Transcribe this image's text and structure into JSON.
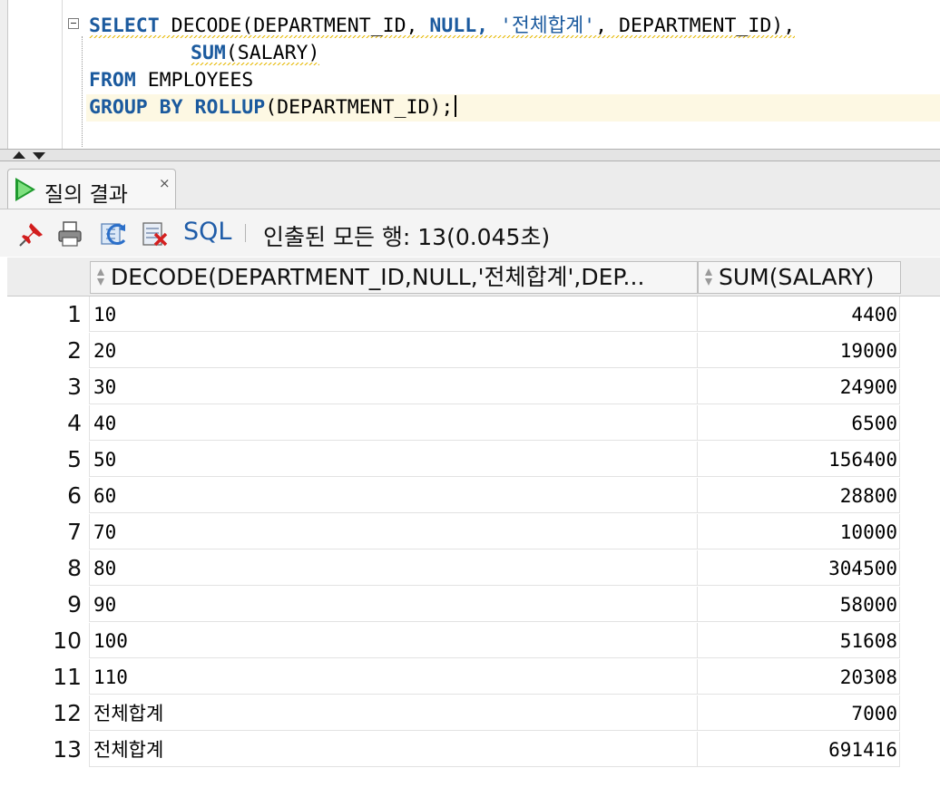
{
  "editor": {
    "line1": {
      "kw_select": "SELECT",
      "fn_decode": "DECODE(DEPARTMENT_ID,",
      "kw_null": "NULL,",
      "str_total": "'전체합계'",
      "rest": ", DEPARTMENT_ID),"
    },
    "line2": {
      "kw_sum": "SUM",
      "rest": "(SALARY)"
    },
    "line3": {
      "kw_from": "FROM",
      "rest": "EMPLOYEES"
    },
    "line4": {
      "kw_group": "GROUP BY",
      "kw_rollup": "ROLLUP",
      "rest": "(DEPARTMENT_ID);"
    }
  },
  "results_tab": {
    "label": "질의 결과",
    "close": "×",
    "icon": "run-query-icon"
  },
  "toolbar": {
    "icons": [
      "pin-icon",
      "print-icon",
      "refresh-icon",
      "clear-icon"
    ],
    "sql_label": "SQL",
    "status": "인출된 모든 행: 13(0.045초)"
  },
  "grid": {
    "columns": [
      "DECODE(DEPARTMENT_ID,NULL,'전체합계',DEP...",
      "SUM(SALARY)"
    ],
    "rows": [
      {
        "n": "1",
        "dept": "10",
        "sum": "4400"
      },
      {
        "n": "2",
        "dept": "20",
        "sum": "19000"
      },
      {
        "n": "3",
        "dept": "30",
        "sum": "24900"
      },
      {
        "n": "4",
        "dept": "40",
        "sum": "6500"
      },
      {
        "n": "5",
        "dept": "50",
        "sum": "156400"
      },
      {
        "n": "6",
        "dept": "60",
        "sum": "28800"
      },
      {
        "n": "7",
        "dept": "70",
        "sum": "10000"
      },
      {
        "n": "8",
        "dept": "80",
        "sum": "304500"
      },
      {
        "n": "9",
        "dept": "90",
        "sum": "58000"
      },
      {
        "n": "10",
        "dept": "100",
        "sum": "51608"
      },
      {
        "n": "11",
        "dept": "110",
        "sum": "20308"
      },
      {
        "n": "12",
        "dept": "전체합계",
        "sum": "7000"
      },
      {
        "n": "13",
        "dept": "전체합계",
        "sum": "691416"
      }
    ]
  },
  "colors": {
    "keyword": "#1b5a9e",
    "sql_button": "#1f5ca8",
    "run_icon": "#1f9a2e"
  }
}
